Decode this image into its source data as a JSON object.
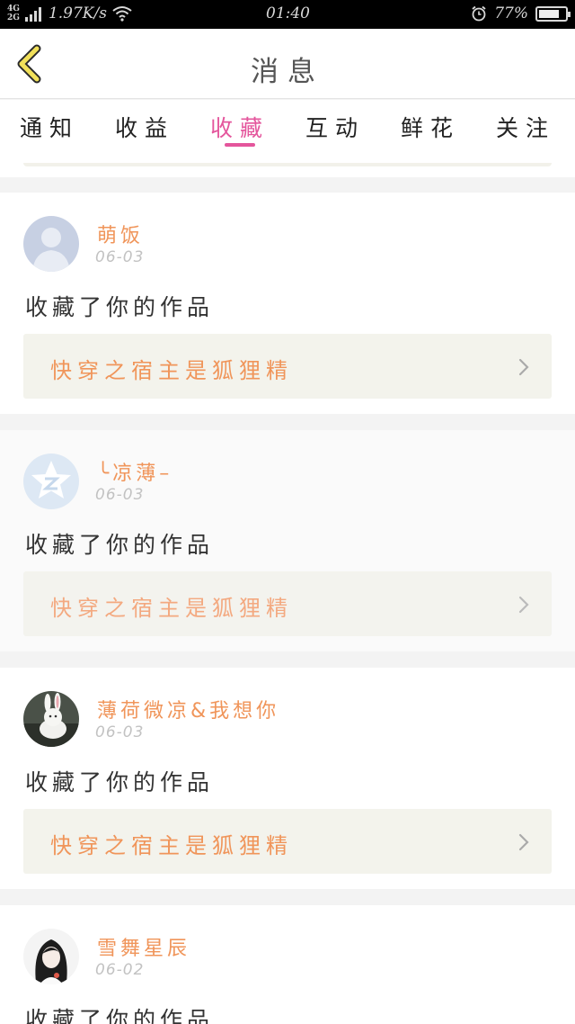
{
  "status_bar": {
    "net_type_top": "4G",
    "net_type_bottom": "2G",
    "speed": "1.97K/s",
    "time": "01:40",
    "battery_pct": "77%",
    "battery_level": 0.77
  },
  "header": {
    "title": "消息"
  },
  "tabs": [
    {
      "label": "通知"
    },
    {
      "label": "收益"
    },
    {
      "label": "收藏"
    },
    {
      "label": "互动"
    },
    {
      "label": "鲜花"
    },
    {
      "label": "关注"
    }
  ],
  "active_tab": "收藏",
  "messages": [
    {
      "username": "萌饭",
      "date": "06-03",
      "action": "收藏了你的作品",
      "work": "快穿之宿主是狐狸精",
      "avatar_icon": "default-user-avatar"
    },
    {
      "username": "╰凉薄–",
      "date": "06-03",
      "action": "收藏了你的作品",
      "work": "快穿之宿主是狐狸精",
      "avatar_icon": "qzone-star-avatar"
    },
    {
      "username": "薄荷微凉&我想你",
      "date": "06-03",
      "action": "收藏了你的作品",
      "work": "快穿之宿主是狐狸精",
      "avatar_icon": "rabbit-photo-avatar"
    },
    {
      "username": "雪舞星辰",
      "date": "06-02",
      "action": "收藏了你的作品",
      "work": "",
      "avatar_icon": "girl-photo-avatar"
    }
  ],
  "colors": {
    "accent_pink": "#e4559c",
    "username_orange": "#f0955a",
    "back_arrow_yellow": "#f2e15a"
  }
}
